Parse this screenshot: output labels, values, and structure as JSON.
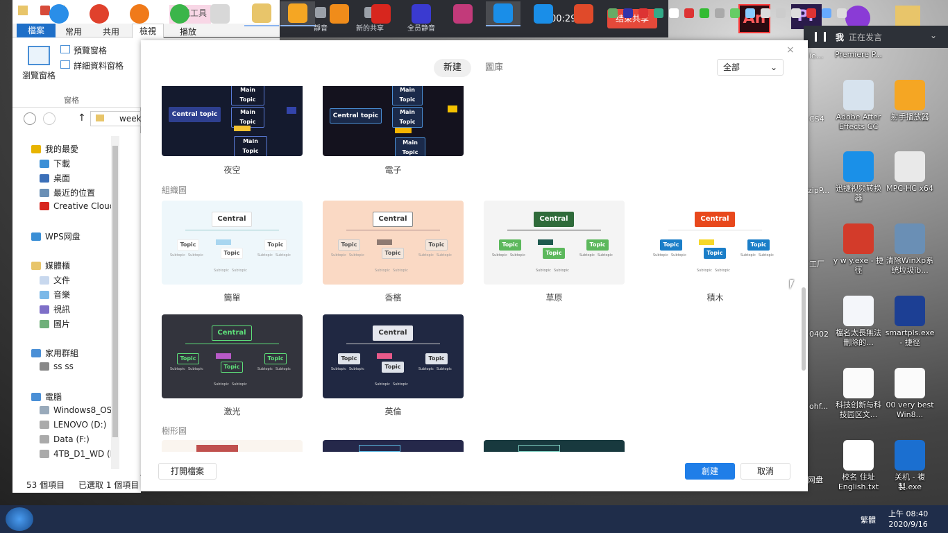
{
  "desktop": {
    "icons": [
      {
        "label": "Premiere P...",
        "color": "#2a1b4b"
      },
      {
        "label": "Adobe After Effects CC",
        "color": "#d7e3ee"
      },
      {
        "label": "射手播放器",
        "color": "#f5a623"
      },
      {
        "label": "迅捷视频转换器",
        "color": "#1a90e8"
      },
      {
        "label": "MPC-HC x64",
        "color": "#e9e9e9"
      },
      {
        "label": "y w y.exe - 捷徑",
        "color": "#d33b2a"
      },
      {
        "label": "清除WinXp系统垃圾ib...",
        "color": "#6a8fb5"
      },
      {
        "label": "檔名太長無法刪除的...",
        "color": "#f4f6fa"
      },
      {
        "label": "smartpls.exe - 捷徑",
        "color": "#1c3f94"
      },
      {
        "label": "科技创新与科技园区文...",
        "color": "#fbfbfb"
      },
      {
        "label": "00 very best Win8...",
        "color": "#fbfbfb"
      },
      {
        "label": "校名 住址 English.txt",
        "color": "#fff"
      },
      {
        "label": "关机 - 複製.exe",
        "color": "#1b6fd0"
      }
    ],
    "partial_labels": [
      "CS4",
      "0402",
      "ohf...",
      "网盘",
      "工厂",
      "zipP...",
      "ie..."
    ]
  },
  "taskbar": {
    "clock_time": "上午 08:40",
    "clock_date": "2020/9/16",
    "lang": "繁體"
  },
  "explorer": {
    "context_tab": "視訊工具",
    "tabs": [
      "檔案",
      "常用",
      "共用",
      "檢視",
      "播放"
    ],
    "panes": [
      "預覽窗格",
      "詳細資料窗格"
    ],
    "browse_pane": "瀏覽窗格",
    "group": "窗格",
    "address": "week",
    "nav": [
      "我的最愛",
      "下載",
      "桌面",
      "最近的位置",
      "Creative Cloud",
      "WPS网盘",
      "媒體櫃",
      "文件",
      "音樂",
      "視訊",
      "圖片",
      "家用群組",
      "ss ss",
      "電腦",
      "Windows8_OS",
      "LENOVO (D:)",
      "Data (F:)",
      "4TB_D1_WD (H"
    ],
    "status_count": "53 個項目",
    "status_selected": "已選取 1 個項目"
  },
  "meeting": {
    "mute": "靜音",
    "new_share": "新的共享",
    "mute_all": "全员静音",
    "timer": "00:29:27",
    "end_share": "结束共享"
  },
  "voice": {
    "speaker": "我",
    "status": "正在发言"
  },
  "dialog": {
    "tabs": [
      "新建",
      "圖庫"
    ],
    "filter": "全部",
    "section_org": "組織圖",
    "section_tree": "樹形圖",
    "row1": [
      {
        "name": "夜空"
      },
      {
        "name": "電子"
      }
    ],
    "row2": [
      {
        "name": "簡單",
        "central": "Central"
      },
      {
        "name": "香檳",
        "central": "Central"
      },
      {
        "name": "草原",
        "central": "Central"
      },
      {
        "name": "積木",
        "central": "Central"
      }
    ],
    "row3": [
      {
        "name": "激光",
        "central": "Central"
      },
      {
        "name": "英倫",
        "central": "Central"
      }
    ],
    "central_topic": "Central topic",
    "main_topic": "Main Topic",
    "topic": "Topic",
    "subtopic": "Subtopic",
    "open_file": "打開檔案",
    "create": "創建",
    "cancel": "取消"
  },
  "colors": {
    "accent": "#1f7ee8",
    "meeting_red": "#e5493a",
    "taskbar": "#1f2d4a"
  }
}
